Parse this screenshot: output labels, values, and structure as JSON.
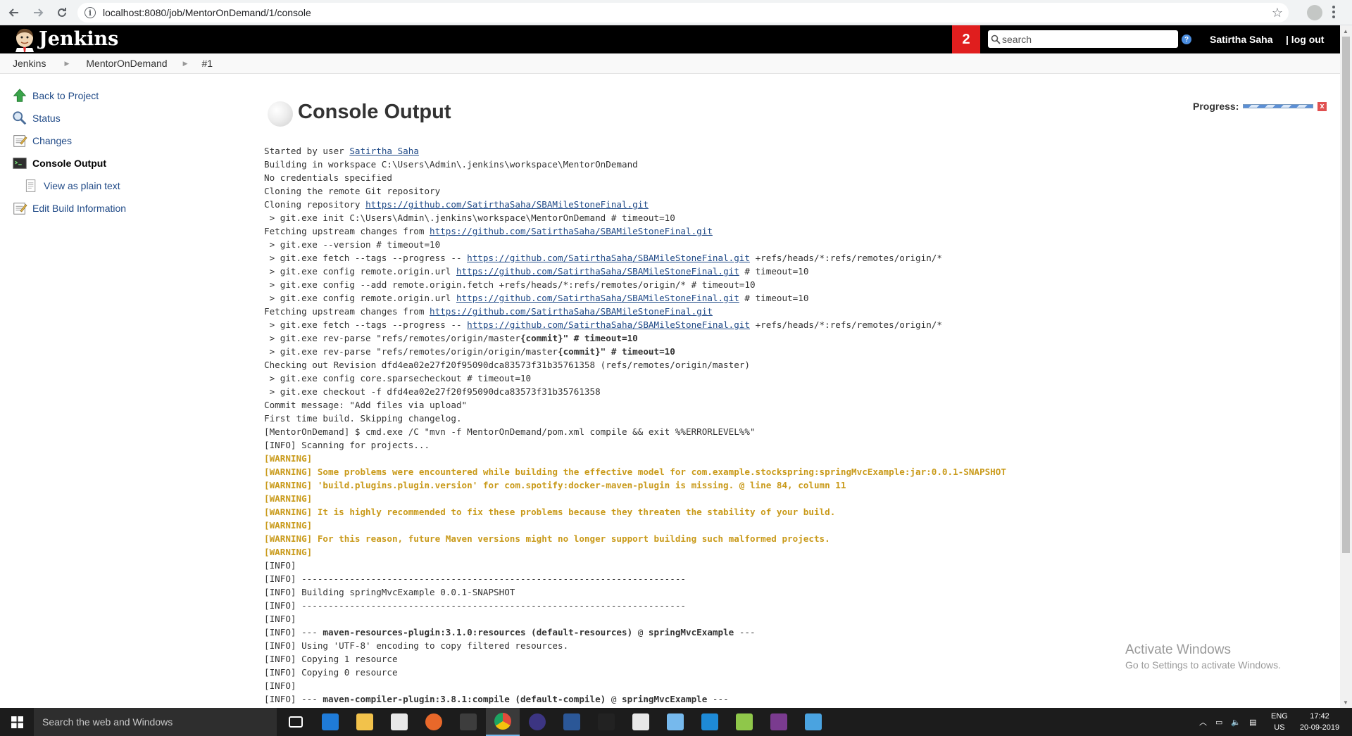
{
  "browser": {
    "url": "localhost:8080/job/MentorOnDemand/1/console"
  },
  "header": {
    "title": "Jenkins",
    "notification_count": "2",
    "search_placeholder": "search",
    "help_label": "?",
    "user_name": "Satirtha Saha",
    "logout_label": "| log out"
  },
  "breadcrumbs": [
    {
      "label": "Jenkins"
    },
    {
      "label": "MentorOnDemand"
    },
    {
      "label": "#1"
    }
  ],
  "side_panel": {
    "items": [
      {
        "label": "Back to Project",
        "icon": "up-arrow-icon"
      },
      {
        "label": "Status",
        "icon": "magnifier-icon"
      },
      {
        "label": "Changes",
        "icon": "notepad-icon"
      },
      {
        "label": "Console Output",
        "icon": "terminal-icon"
      },
      {
        "label": "View as plain text",
        "icon": "document-icon"
      },
      {
        "label": "Edit Build Information",
        "icon": "notepad-edit-icon"
      }
    ]
  },
  "main": {
    "title": "Console Output",
    "progress_label": "Progress:",
    "stop_symbol": "x"
  },
  "console_lines": [
    "Started by user |Satirtha Saha|",
    "Building in workspace C:\\Users\\Admin\\.jenkins\\workspace\\MentorOnDemand",
    "No credentials specified",
    "Cloning the remote Git repository",
    "Cloning repository |https://github.com/SatirthaSaha/SBAMileStoneFinal.git|",
    " > git.exe init C:\\Users\\Admin\\.jenkins\\workspace\\MentorOnDemand # timeout=10",
    "Fetching upstream changes from |https://github.com/SatirthaSaha/SBAMileStoneFinal.git|",
    " > git.exe --version # timeout=10",
    " > git.exe fetch --tags --progress -- |https://github.com/SatirthaSaha/SBAMileStoneFinal.git| +refs/heads/*:refs/remotes/origin/*",
    " > git.exe config remote.origin.url |https://github.com/SatirthaSaha/SBAMileStoneFinal.git| # timeout=10",
    " > git.exe config --add remote.origin.fetch +refs/heads/*:refs/remotes/origin/* # timeout=10",
    " > git.exe config remote.origin.url |https://github.com/SatirthaSaha/SBAMileStoneFinal.git| # timeout=10",
    "Fetching upstream changes from |https://github.com/SatirthaSaha/SBAMileStoneFinal.git|",
    " > git.exe fetch --tags --progress -- |https://github.com/SatirthaSaha/SBAMileStoneFinal.git| +refs/heads/*:refs/remotes/origin/*",
    " > git.exe rev-parse \"refs/remotes/origin/master^{commit}\" # timeout=10",
    " > git.exe rev-parse \"refs/remotes/origin/origin/master^{commit}\" # timeout=10",
    "Checking out Revision dfd4ea02e27f20f95090dca83573f31b35761358 (refs/remotes/origin/master)",
    " > git.exe config core.sparsecheckout # timeout=10",
    " > git.exe checkout -f dfd4ea02e27f20f95090dca83573f31b35761358",
    "Commit message: \"Add files via upload\"",
    "First time build. Skipping changelog.",
    "[MentorOnDemand] $ cmd.exe /C \"mvn -f MentorOnDemand/pom.xml compile && exit %%ERRORLEVEL%%\"",
    "[INFO] Scanning for projects...",
    "[WARNING]",
    "[WARNING] Some problems were encountered while building the effective model for com.example.stockspring:springMvcExample:jar:0.0.1-SNAPSHOT",
    "[WARNING] 'build.plugins.plugin.version' for com.spotify:docker-maven-plugin is missing. @ line 84, column 11",
    "[WARNING]",
    "[WARNING] It is highly recommended to fix these problems because they threaten the stability of your build.",
    "[WARNING]",
    "[WARNING] For this reason, future Maven versions might no longer support building such malformed projects.",
    "[WARNING]",
    "[INFO]",
    "[INFO] ------------------------------------------------------------------------",
    "[INFO] Building springMvcExample 0.0.1-SNAPSHOT",
    "[INFO] ------------------------------------------------------------------------",
    "[INFO]",
    "[INFO] --- ^maven-resources-plugin:3.1.0:resources (default-resources)^ @ ^springMvcExample^ ---",
    "[INFO] Using 'UTF-8' encoding to copy filtered resources.",
    "[INFO] Copying 1 resource",
    "[INFO] Copying 0 resource",
    "[INFO]",
    "[INFO] --- ^maven-compiler-plugin:3.8.1:compile (default-compile)^ @ ^springMvcExample^ ---"
  ],
  "watermark": {
    "line1": "Activate Windows",
    "line2": "Go to Settings to activate Windows."
  },
  "taskbar": {
    "search_placeholder": "Search the web and Windows",
    "lang_line1": "ENG",
    "lang_line2": "US",
    "time": "17:42",
    "date": "20-09-2019",
    "apps": [
      {
        "icon": "task-view-icon",
        "color": "#1c1c1c"
      },
      {
        "icon": "edge-icon",
        "color": "#1f7bd8"
      },
      {
        "icon": "file-explorer-icon",
        "color": "#f2c24b"
      },
      {
        "icon": "store-icon",
        "color": "#e8e8e8"
      },
      {
        "icon": "firefox-icon",
        "color": "#e8682a"
      },
      {
        "icon": "pycharm-icon",
        "color": "#3d3d3d"
      },
      {
        "icon": "chrome-icon",
        "color": "#e24b3b"
      },
      {
        "icon": "eclipse-icon",
        "color": "#3c3582"
      },
      {
        "icon": "visual-studio-icon",
        "color": "#2b5797"
      },
      {
        "icon": "command-prompt-icon",
        "color": "#222222"
      },
      {
        "icon": "photos-icon",
        "color": "#e8e8e8"
      },
      {
        "icon": "notepad-icon",
        "color": "#76b9ed"
      },
      {
        "icon": "vscode-icon",
        "color": "#1e8ad6"
      },
      {
        "icon": "notepadpp-icon",
        "color": "#8fc74a"
      },
      {
        "icon": "ide-icon",
        "color": "#7a3b8f"
      },
      {
        "icon": "remote-desktop-icon",
        "color": "#4aa3e0"
      }
    ]
  }
}
